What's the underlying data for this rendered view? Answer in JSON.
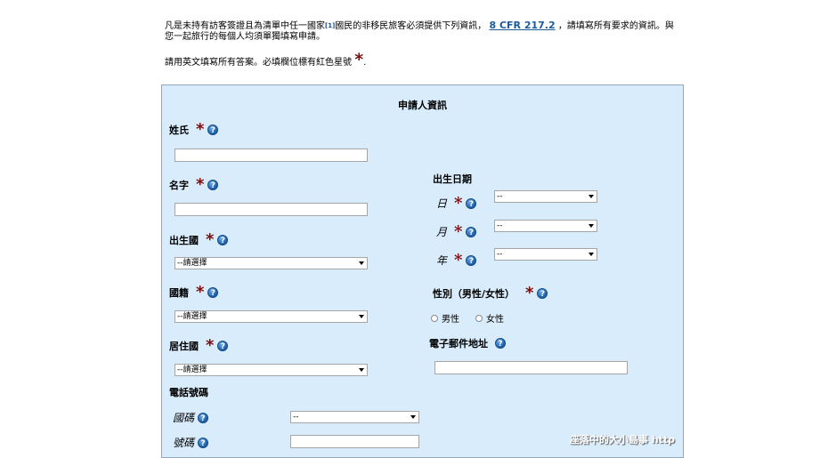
{
  "intro": {
    "text1": "凡是未持有訪客簽證且為清單中任一國家",
    "ref": "[1]",
    "text2": "國民的非移民旅客必須提供下列資訊，",
    "link": "8 CFR 217.2",
    "text3": "，請填寫所有要求的資訊。與您一起旅行的每個人均須單獨填寫申請。"
  },
  "note": {
    "text": "請用英文填寫所有答案。必填欄位標有紅色星號",
    "star": "*",
    "end": "."
  },
  "panel": {
    "title": "申請人資訊",
    "surname_label": "姓氏",
    "given_name_label": "名字",
    "birth_country_label": "出生國",
    "nationality_label": "國籍",
    "residence_label": "居住國",
    "phone_label": "電話號碼",
    "phone_country_label": "國碼",
    "phone_number_label": "號碼",
    "dob_label": "出生日期",
    "day_label": "日",
    "month_label": "月",
    "year_label": "年",
    "gender_label": "性別（男性/女性）",
    "male_label": "男性",
    "female_label": "女性",
    "email_label": "電子郵件地址",
    "select_placeholder": "--請選擇",
    "dash_option": "--",
    "star": "*",
    "help": "?"
  },
  "watermark": "座落中的大小島事 http"
}
